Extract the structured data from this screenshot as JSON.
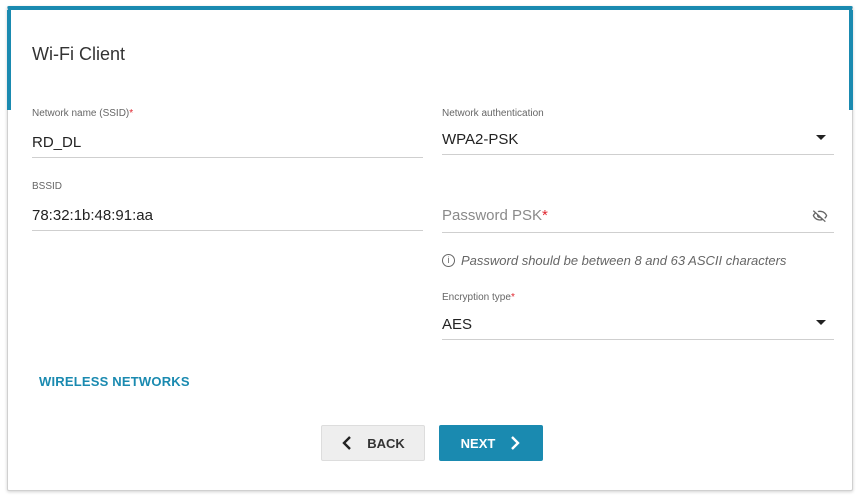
{
  "page": {
    "title": "Wi-Fi Client"
  },
  "fields": {
    "ssid": {
      "label": "Network name (SSID)",
      "required_mark": "*",
      "value": "RD_DL"
    },
    "bssid": {
      "label": "BSSID",
      "value": "78:32:1b:48:91:aa"
    },
    "auth": {
      "label": "Network authentication",
      "value": "WPA2-PSK"
    },
    "password": {
      "placeholder": "Password PSK",
      "required_mark": "*"
    },
    "password_hint": "Password should be between 8 and 63 ASCII characters",
    "encryption": {
      "label": "Encryption type",
      "required_mark": "*",
      "value": "AES"
    }
  },
  "links": {
    "wireless_networks": "WIRELESS NETWORKS"
  },
  "buttons": {
    "back": "BACK",
    "next": "NEXT"
  },
  "icons": {
    "password_toggle": "eye-off-icon",
    "hint": "info-icon",
    "back": "chevron-left-icon",
    "next": "chevron-right-icon",
    "dropdown": "caret-down-icon"
  },
  "colors": {
    "accent": "#1a8ab0",
    "required": "#e0262f"
  }
}
